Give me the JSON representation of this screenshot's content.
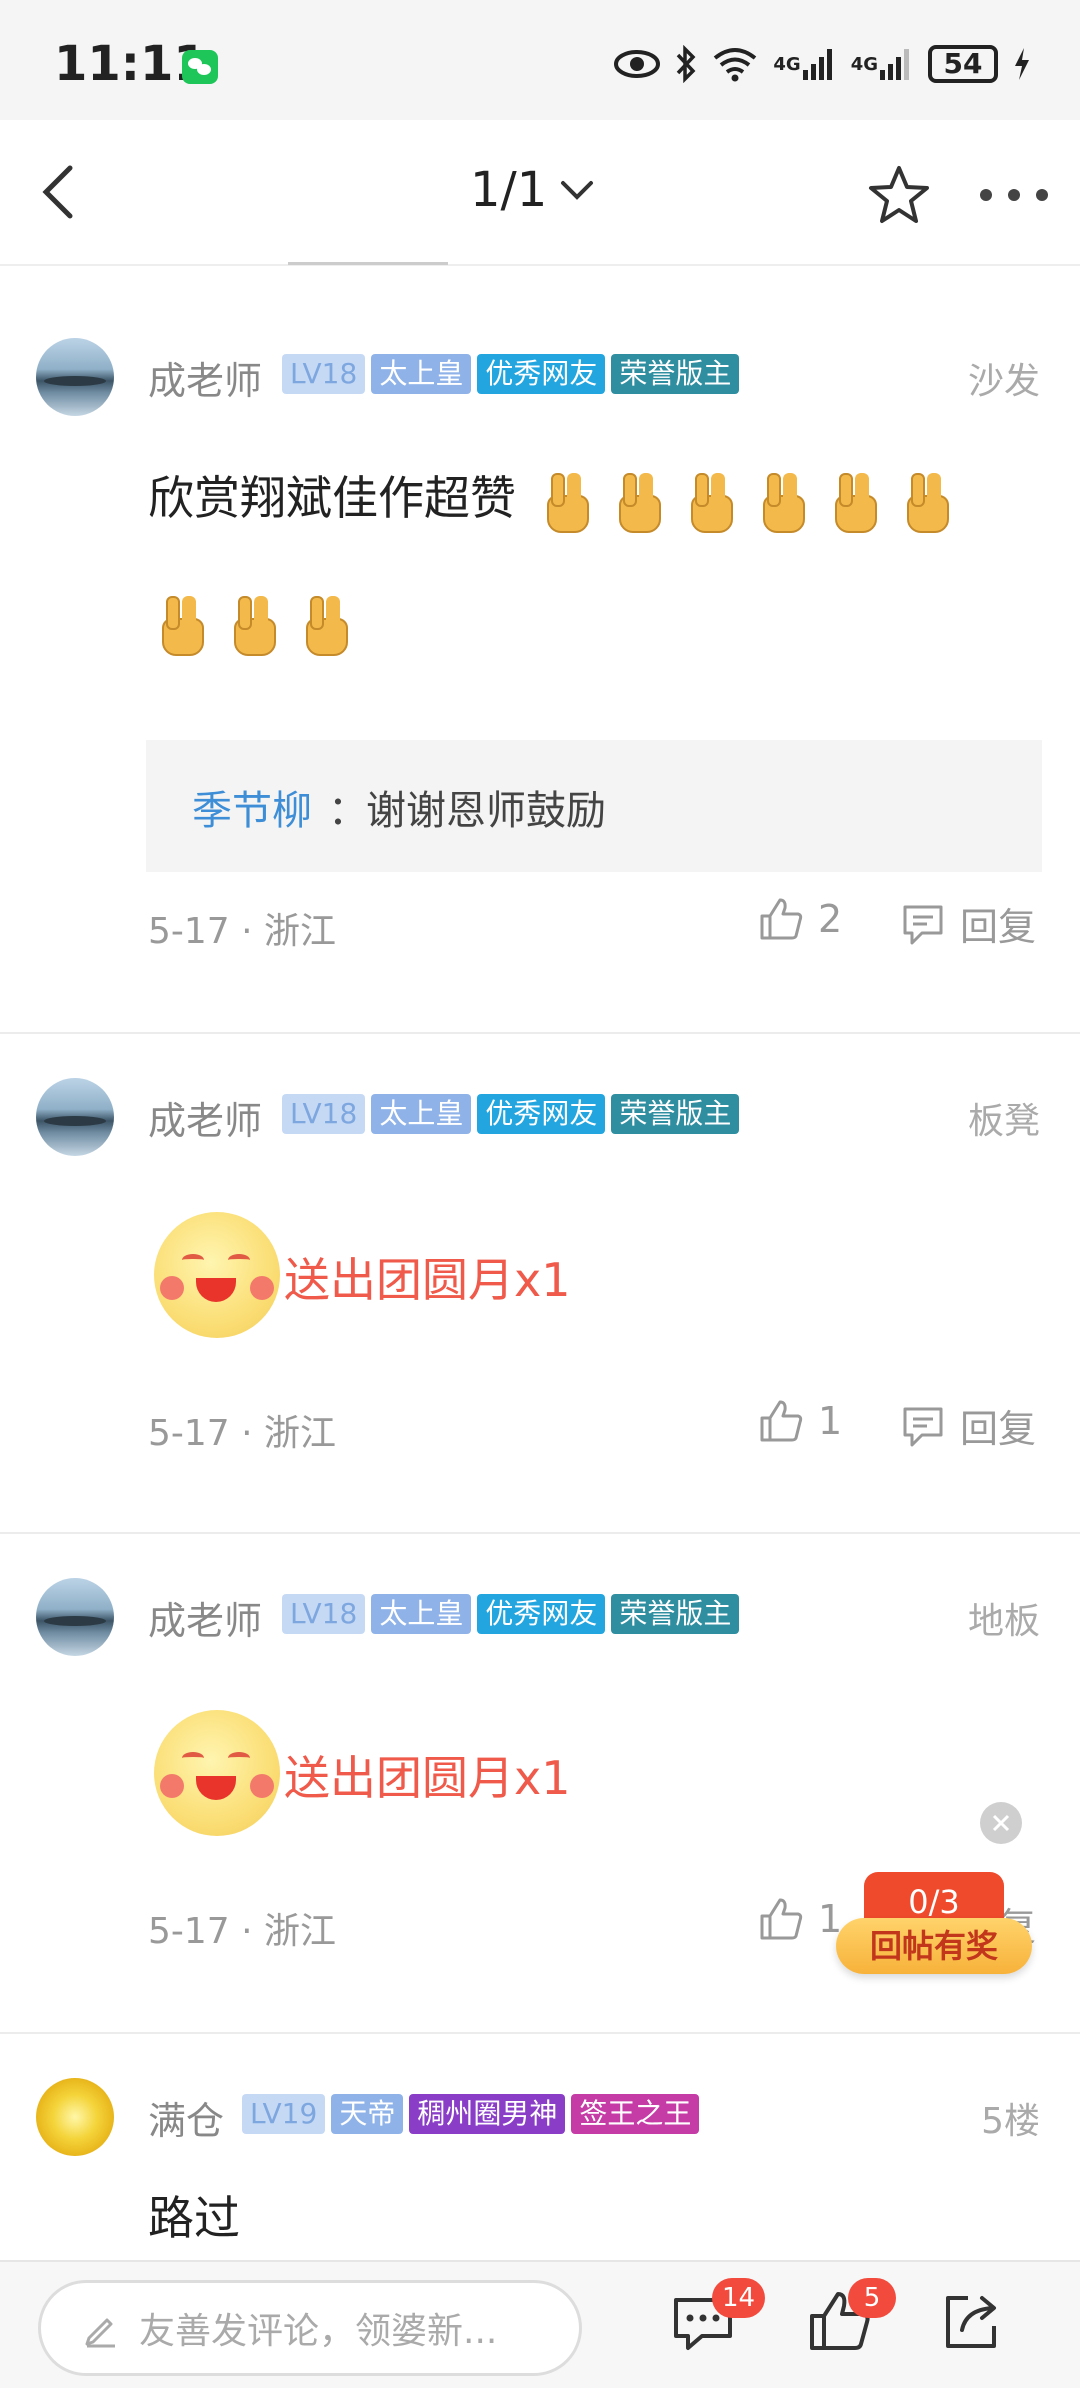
{
  "status_bar": {
    "time": "11:11",
    "network1": "4G",
    "network2": "4G",
    "battery": "54"
  },
  "nav": {
    "page_indicator": "1/1"
  },
  "posts": [
    {
      "username": "成老师",
      "badges": [
        "LV18",
        "太上皇",
        "优秀网友",
        "荣誉版主"
      ],
      "floor": "沙发",
      "text": "欣赏翔斌佳作超赞",
      "victory_count_line1": 6,
      "victory_count_line2": 3,
      "reply": {
        "name": "季节柳",
        "sep": "：",
        "text": "谢谢恩师鼓励"
      },
      "meta": "5-17 · 浙江",
      "likes": "2",
      "reply_label": "回复"
    },
    {
      "username": "成老师",
      "badges": [
        "LV18",
        "太上皇",
        "优秀网友",
        "荣誉版主"
      ],
      "floor": "板凳",
      "gift_text": "送出团圆月x1",
      "meta": "5-17 · 浙江",
      "likes": "1",
      "reply_label": "回复"
    },
    {
      "username": "成老师",
      "badges": [
        "LV18",
        "太上皇",
        "优秀网友",
        "荣誉版主"
      ],
      "floor": "地板",
      "gift_text": "送出团圆月x1",
      "meta": "5-17 · 浙江",
      "likes": "1",
      "reply_label": "回复"
    },
    {
      "username": "满仓",
      "badges": [
        "LV19",
        "天帝",
        "稠州圈男神",
        "签王之王"
      ],
      "floor": "5楼",
      "text": "路过"
    }
  ],
  "reward_float": {
    "progress": "0/3",
    "label": "回帖有奖"
  },
  "bottom_bar": {
    "comment_placeholder": "友善发评论，领婆新...",
    "comment_count": "14",
    "like_count": "5"
  }
}
